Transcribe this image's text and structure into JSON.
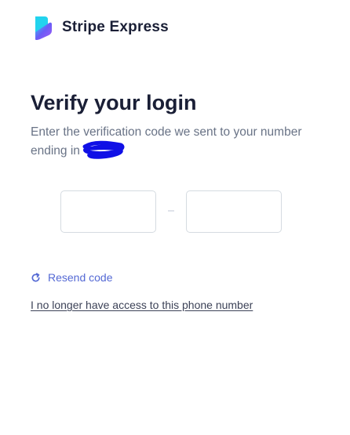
{
  "brand": {
    "name": "Stripe Express"
  },
  "verify": {
    "title": "Verify your login",
    "subtitle": "Enter the verification code we sent to your number ending in",
    "code_group_1": [
      "",
      "",
      ""
    ],
    "code_group_2": [
      "",
      "",
      ""
    ]
  },
  "actions": {
    "resend_label": "Resend code",
    "no_access_label": "I no longer have access to this phone number"
  },
  "colors": {
    "text_primary": "#1a1f36",
    "text_secondary": "#697386",
    "link": "#5469d4",
    "border": "#d5dbe1",
    "redaction": "#1010e6"
  }
}
